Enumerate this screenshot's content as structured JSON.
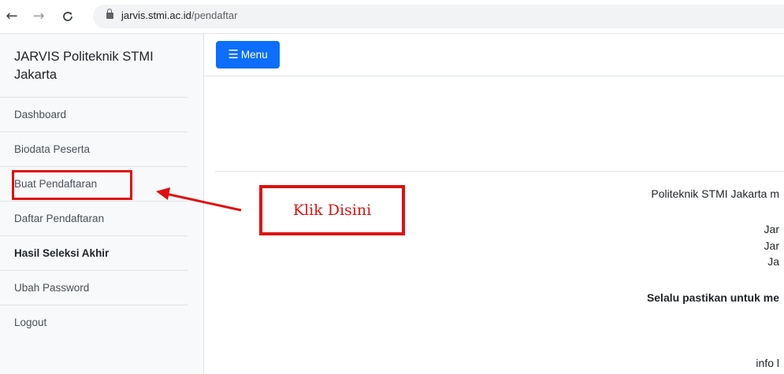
{
  "browser": {
    "url_domain": "jarvis.stmi.ac.id",
    "url_path": "/pendaftar"
  },
  "sidebar": {
    "brand": "JARVIS Politeknik STMI Jakarta",
    "items": [
      {
        "label": "Dashboard"
      },
      {
        "label": "Biodata Peserta"
      },
      {
        "label": "Buat Pendaftaran"
      },
      {
        "label": "Daftar Pendaftaran"
      },
      {
        "label": "Hasil Seleksi Akhir"
      },
      {
        "label": "Ubah Password"
      },
      {
        "label": "Logout"
      }
    ]
  },
  "topbar": {
    "menu_label": "Menu"
  },
  "main": {
    "line1": "Politeknik STMI Jakarta m",
    "line2": "Jar",
    "line3": "Jar",
    "line4": "Ja",
    "line5": "Selalu pastikan untuk me",
    "line6": "info l"
  },
  "annotation": {
    "text": "Klik Disini",
    "color": "#e01010"
  },
  "colors": {
    "menu_button": "#0d6efd",
    "sidebar_bg": "#f8f9fa"
  }
}
